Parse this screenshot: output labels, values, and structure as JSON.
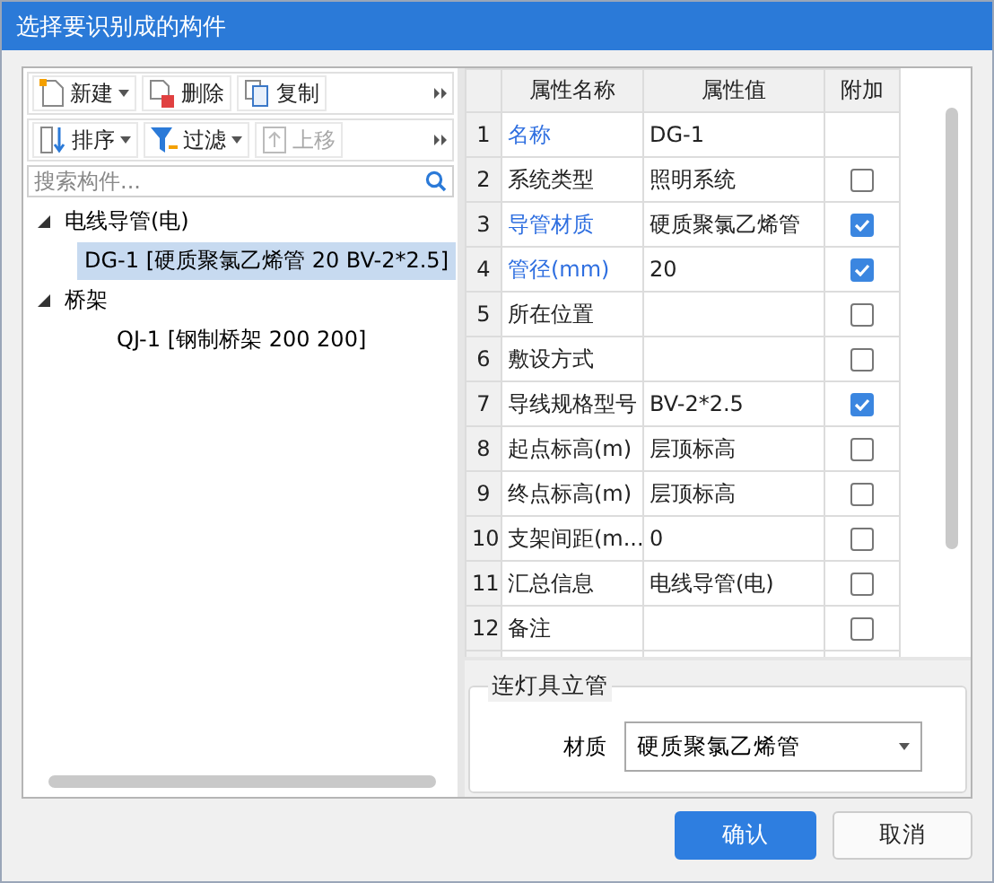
{
  "window": {
    "title": "选择要识别成的构件"
  },
  "toolbar_1": [
    {
      "label": "新建",
      "kind": "new",
      "dropdown": true
    },
    {
      "label": "删除",
      "kind": "delete",
      "dropdown": false
    },
    {
      "label": "复制",
      "kind": "copy",
      "dropdown": false
    }
  ],
  "toolbar_2": [
    {
      "label": "排序",
      "kind": "sort",
      "dropdown": true,
      "disabled": false
    },
    {
      "label": "过滤",
      "kind": "filter",
      "dropdown": true,
      "disabled": false
    },
    {
      "label": "上移",
      "kind": "up",
      "dropdown": false,
      "disabled": true
    }
  ],
  "search": {
    "placeholder": "搜索构件..."
  },
  "tree": [
    {
      "label": "电线导管(电)",
      "expanded": true,
      "children": [
        {
          "label": "DG-1 [硬质聚氯乙烯管 20 BV-2*2.5]",
          "selected": true
        }
      ]
    },
    {
      "label": "桥架",
      "expanded": true,
      "children": [
        {
          "label": "QJ-1 [钢制桥架 200 200]",
          "selected": false
        }
      ]
    }
  ],
  "table": {
    "columns": [
      "属性名称",
      "属性值",
      "附加"
    ],
    "rows": [
      {
        "index": "1",
        "name": "名称",
        "value": "DG-1",
        "highlight": true,
        "kind": "plain"
      },
      {
        "index": "2",
        "name": "系统类型",
        "value": "照明系统",
        "highlight": false,
        "kind": "checkbox",
        "checked": false
      },
      {
        "index": "3",
        "name": "导管材质",
        "value": "硬质聚氯乙烯管",
        "highlight": true,
        "kind": "checkbox",
        "checked": true
      },
      {
        "index": "4",
        "name": "管径(mm)",
        "value": "20",
        "highlight": true,
        "kind": "checkbox",
        "checked": true
      },
      {
        "index": "5",
        "name": "所在位置",
        "value": "",
        "highlight": false,
        "kind": "checkbox",
        "checked": false
      },
      {
        "index": "6",
        "name": "敷设方式",
        "value": "",
        "highlight": false,
        "kind": "checkbox",
        "checked": false
      },
      {
        "index": "7",
        "name": "导线规格型号",
        "value": "BV-2*2.5",
        "highlight": false,
        "kind": "checkbox",
        "checked": true
      },
      {
        "index": "8",
        "name": "起点标高(m)",
        "value": "层顶标高",
        "highlight": false,
        "kind": "checkbox",
        "checked": false
      },
      {
        "index": "9",
        "name": "终点标高(m)",
        "value": "层顶标高",
        "highlight": false,
        "kind": "checkbox",
        "checked": false
      },
      {
        "index": "10",
        "name": "支架间距(m...",
        "value": "0",
        "highlight": false,
        "kind": "checkbox",
        "checked": false
      },
      {
        "index": "11",
        "name": "汇总信息",
        "value": "电线导管(电)",
        "highlight": false,
        "kind": "checkbox",
        "checked": false
      },
      {
        "index": "12",
        "name": "备注",
        "value": "",
        "highlight": false,
        "kind": "checkbox",
        "checked": false
      }
    ]
  },
  "group": {
    "title": "连灯具立管",
    "field_label": "材质",
    "field_value": "硬质聚氯乙烯管"
  },
  "buttons": [
    {
      "label": "确认",
      "primary": true
    },
    {
      "label": "取消",
      "primary": false
    }
  ]
}
